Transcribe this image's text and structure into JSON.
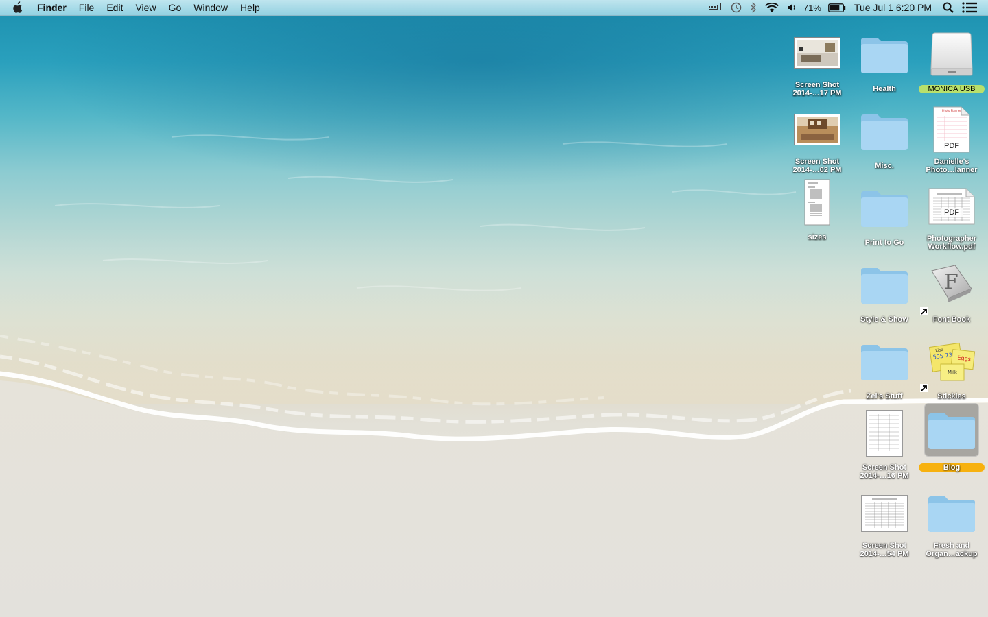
{
  "menubar": {
    "apple_icon": "apple-logo-icon",
    "app_name": "Finder",
    "items": [
      "File",
      "Edit",
      "View",
      "Go",
      "Window",
      "Help"
    ],
    "status": {
      "battery_percent": "71%",
      "clock": "Tue Jul 1  6:20 PM"
    }
  },
  "desktop": {
    "icons": [
      {
        "line1": "Screen Shot",
        "line2": "2014-…17 PM",
        "kind": "screenshot"
      },
      {
        "line1": "Health",
        "line2": "",
        "kind": "folder"
      },
      {
        "line1": "MONICA USB",
        "line2": "",
        "kind": "drive"
      },
      {
        "line1": "Screen Shot",
        "line2": "2014-…02 PM",
        "kind": "screenshot"
      },
      {
        "line1": "Misc.",
        "line2": "",
        "kind": "folder"
      },
      {
        "line1": "Danielle's",
        "line2": "Photo…lanner",
        "kind": "pdf",
        "badge": "PDF"
      },
      {
        "line1": "sizes",
        "line2": "",
        "kind": "document"
      },
      {
        "line1": "Print to Go",
        "line2": "",
        "kind": "folder"
      },
      {
        "line1": "Photographer",
        "line2": "Workflow.pdf",
        "kind": "pdf",
        "badge": "PDF"
      },
      {
        "line1": "Style & Show",
        "line2": "",
        "kind": "folder"
      },
      {
        "line1": "Font Book",
        "line2": "",
        "kind": "app-alias",
        "glyph": "F"
      },
      {
        "line1": "Zel's Stuff",
        "line2": "",
        "kind": "folder"
      },
      {
        "line1": "Stickies",
        "line2": "",
        "kind": "app-alias",
        "note1": "555-7361",
        "note2": "Eggs",
        "note3": "Milk",
        "note0": "Lisa"
      },
      {
        "line1": "Screen Shot",
        "line2": "2014-…16 PM",
        "kind": "screenshot"
      },
      {
        "line1": "Blog",
        "line2": "",
        "kind": "folder-selected"
      },
      {
        "line1": "Screen Shot",
        "line2": "2014-…54 PM",
        "kind": "screenshot"
      },
      {
        "line1": "Fresh and",
        "line2": "Organ…ackup",
        "kind": "folder"
      }
    ]
  }
}
